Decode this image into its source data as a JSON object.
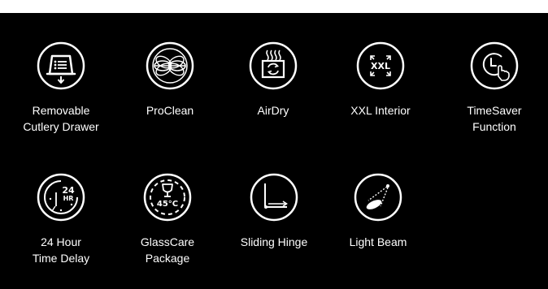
{
  "features": [
    {
      "icon": "cutlery-drawer-icon",
      "label": "Removable\nCutlery Drawer"
    },
    {
      "icon": "proclean-icon",
      "label": "ProClean"
    },
    {
      "icon": "airdry-icon",
      "label": "AirDry"
    },
    {
      "icon": "xxl-interior-icon",
      "label": "XXL Interior",
      "icon_text": "XXL"
    },
    {
      "icon": "timesaver-icon",
      "label": "TimeSaver\nFunction"
    },
    {
      "icon": "time-delay-24h-icon",
      "label": "24 Hour\nTime Delay",
      "icon_text_top": "24",
      "icon_text_bottom": "HR"
    },
    {
      "icon": "glasscare-icon",
      "label": "GlassCare\nPackage",
      "icon_text": "45°C"
    },
    {
      "icon": "sliding-hinge-icon",
      "label": "Sliding Hinge"
    },
    {
      "icon": "light-beam-icon",
      "label": "Light Beam"
    }
  ],
  "colors": {
    "background": "#000000",
    "foreground": "#ffffff",
    "top_strip": "#ffffff"
  }
}
